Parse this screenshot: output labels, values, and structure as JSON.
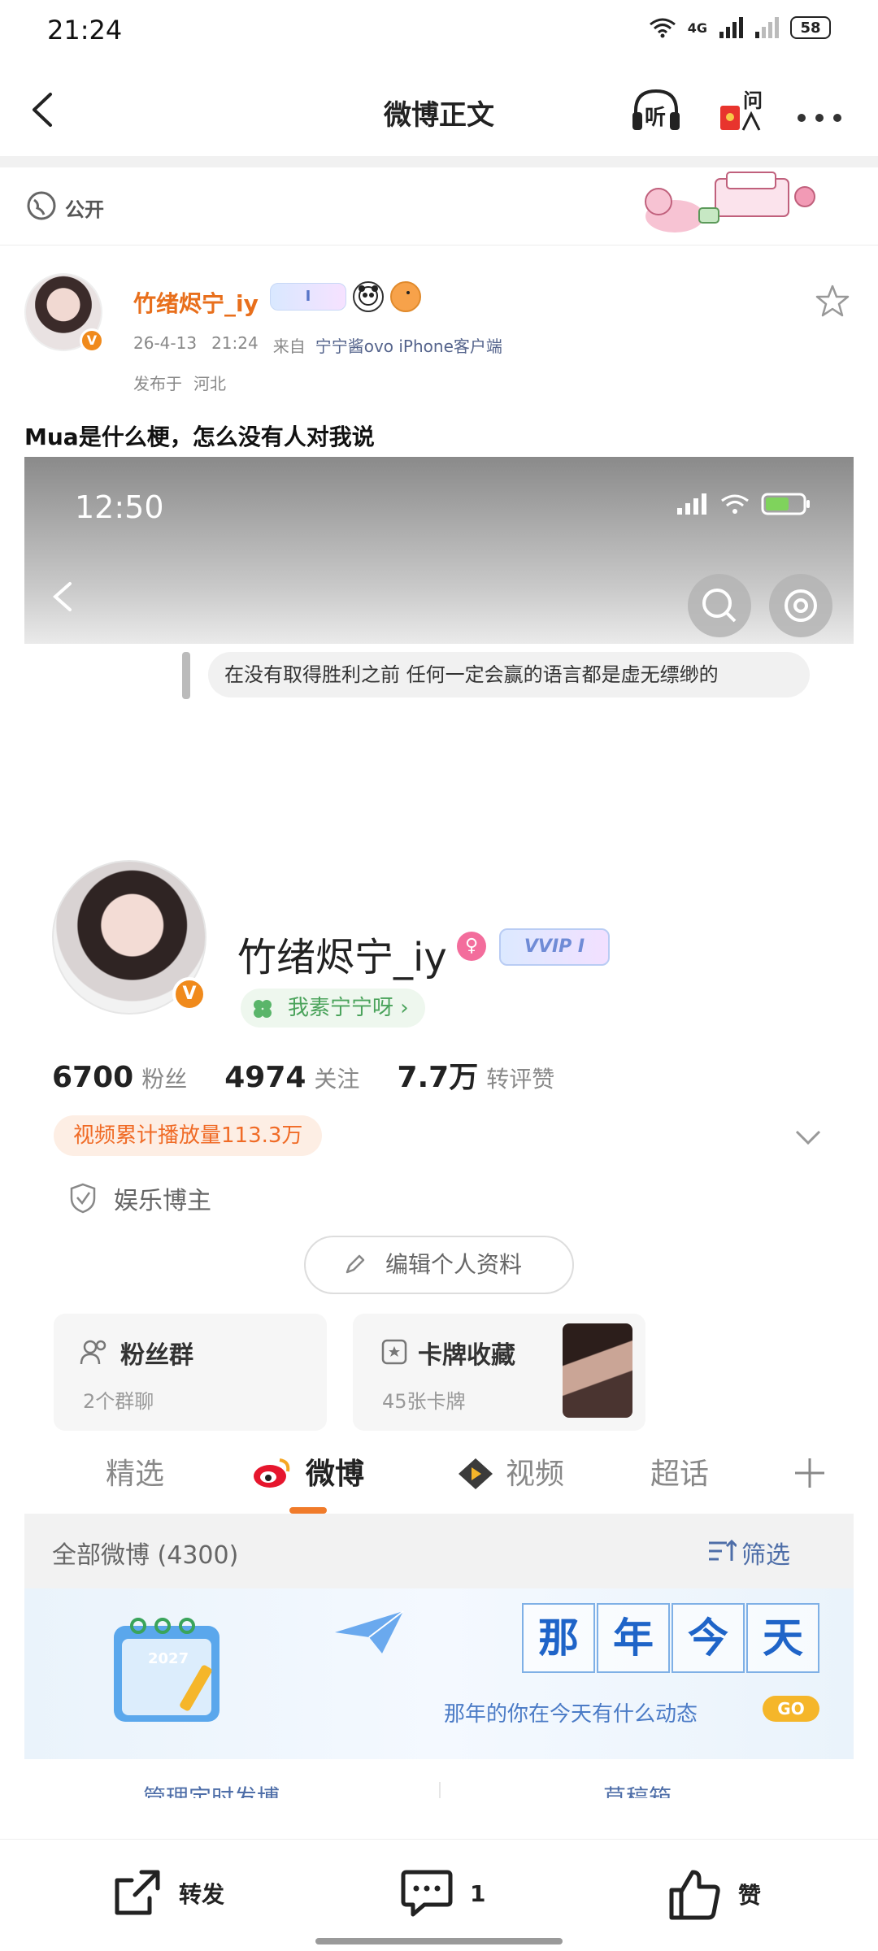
{
  "status_bar": {
    "time": "21:24",
    "network": "4G",
    "battery": "58"
  },
  "nav": {
    "title": "微博正文",
    "listen_label": "听",
    "ask_label": "问"
  },
  "visibility": {
    "label": "公开"
  },
  "post": {
    "author": "竹绪烬宁_iy",
    "badge_text": "I",
    "date": "26-4-13",
    "time": "21:24",
    "from_prefix": "来自",
    "source": "宁宁酱ovo iPhone客户端",
    "location_prefix": "发布于",
    "location": "河北",
    "text": "Mua是什么梗，怎么没有人对我说"
  },
  "screenshot": {
    "time": "12:50",
    "quote": "在没有取得胜利之前 任何一定会赢的语言都是虚无缥缈的",
    "profile": {
      "name": "竹绪烬宁_iy",
      "gender_symbol": "♀",
      "vip_badge": "VVIP I",
      "tag": "我素宁宁呀 ›",
      "stats": [
        {
          "num": "6700",
          "label": "粉丝"
        },
        {
          "num": "4974",
          "label": "关注"
        },
        {
          "num": "7.7万",
          "label": "转评赞"
        }
      ],
      "plays": "视频累计播放量113.3万",
      "category": "娱乐博主",
      "edit_button": "编辑个人资料",
      "cards": [
        {
          "title": "粉丝群",
          "sub": "2个群聊"
        },
        {
          "title": "卡牌收藏",
          "sub": "45张卡牌"
        }
      ],
      "tabs": [
        "精选",
        "微博",
        "视频",
        "超话"
      ],
      "active_tab": "微博",
      "list_title": "全部微博 (4300)",
      "filter": "筛选",
      "banner": {
        "chars": [
          "那",
          "年",
          "今",
          "天"
        ],
        "sub": "那年的你在今天有什么动态",
        "go": "GO",
        "calendar_year": "2027"
      },
      "tools": [
        "管理定时发博",
        "草稿箱"
      ]
    }
  },
  "bottom_bar": {
    "repost": "转发",
    "comment_count": "1",
    "like": "赞"
  },
  "colors": {
    "accent": "#f07b2a",
    "link": "#4e6ea8",
    "author": "#e86f1c"
  }
}
